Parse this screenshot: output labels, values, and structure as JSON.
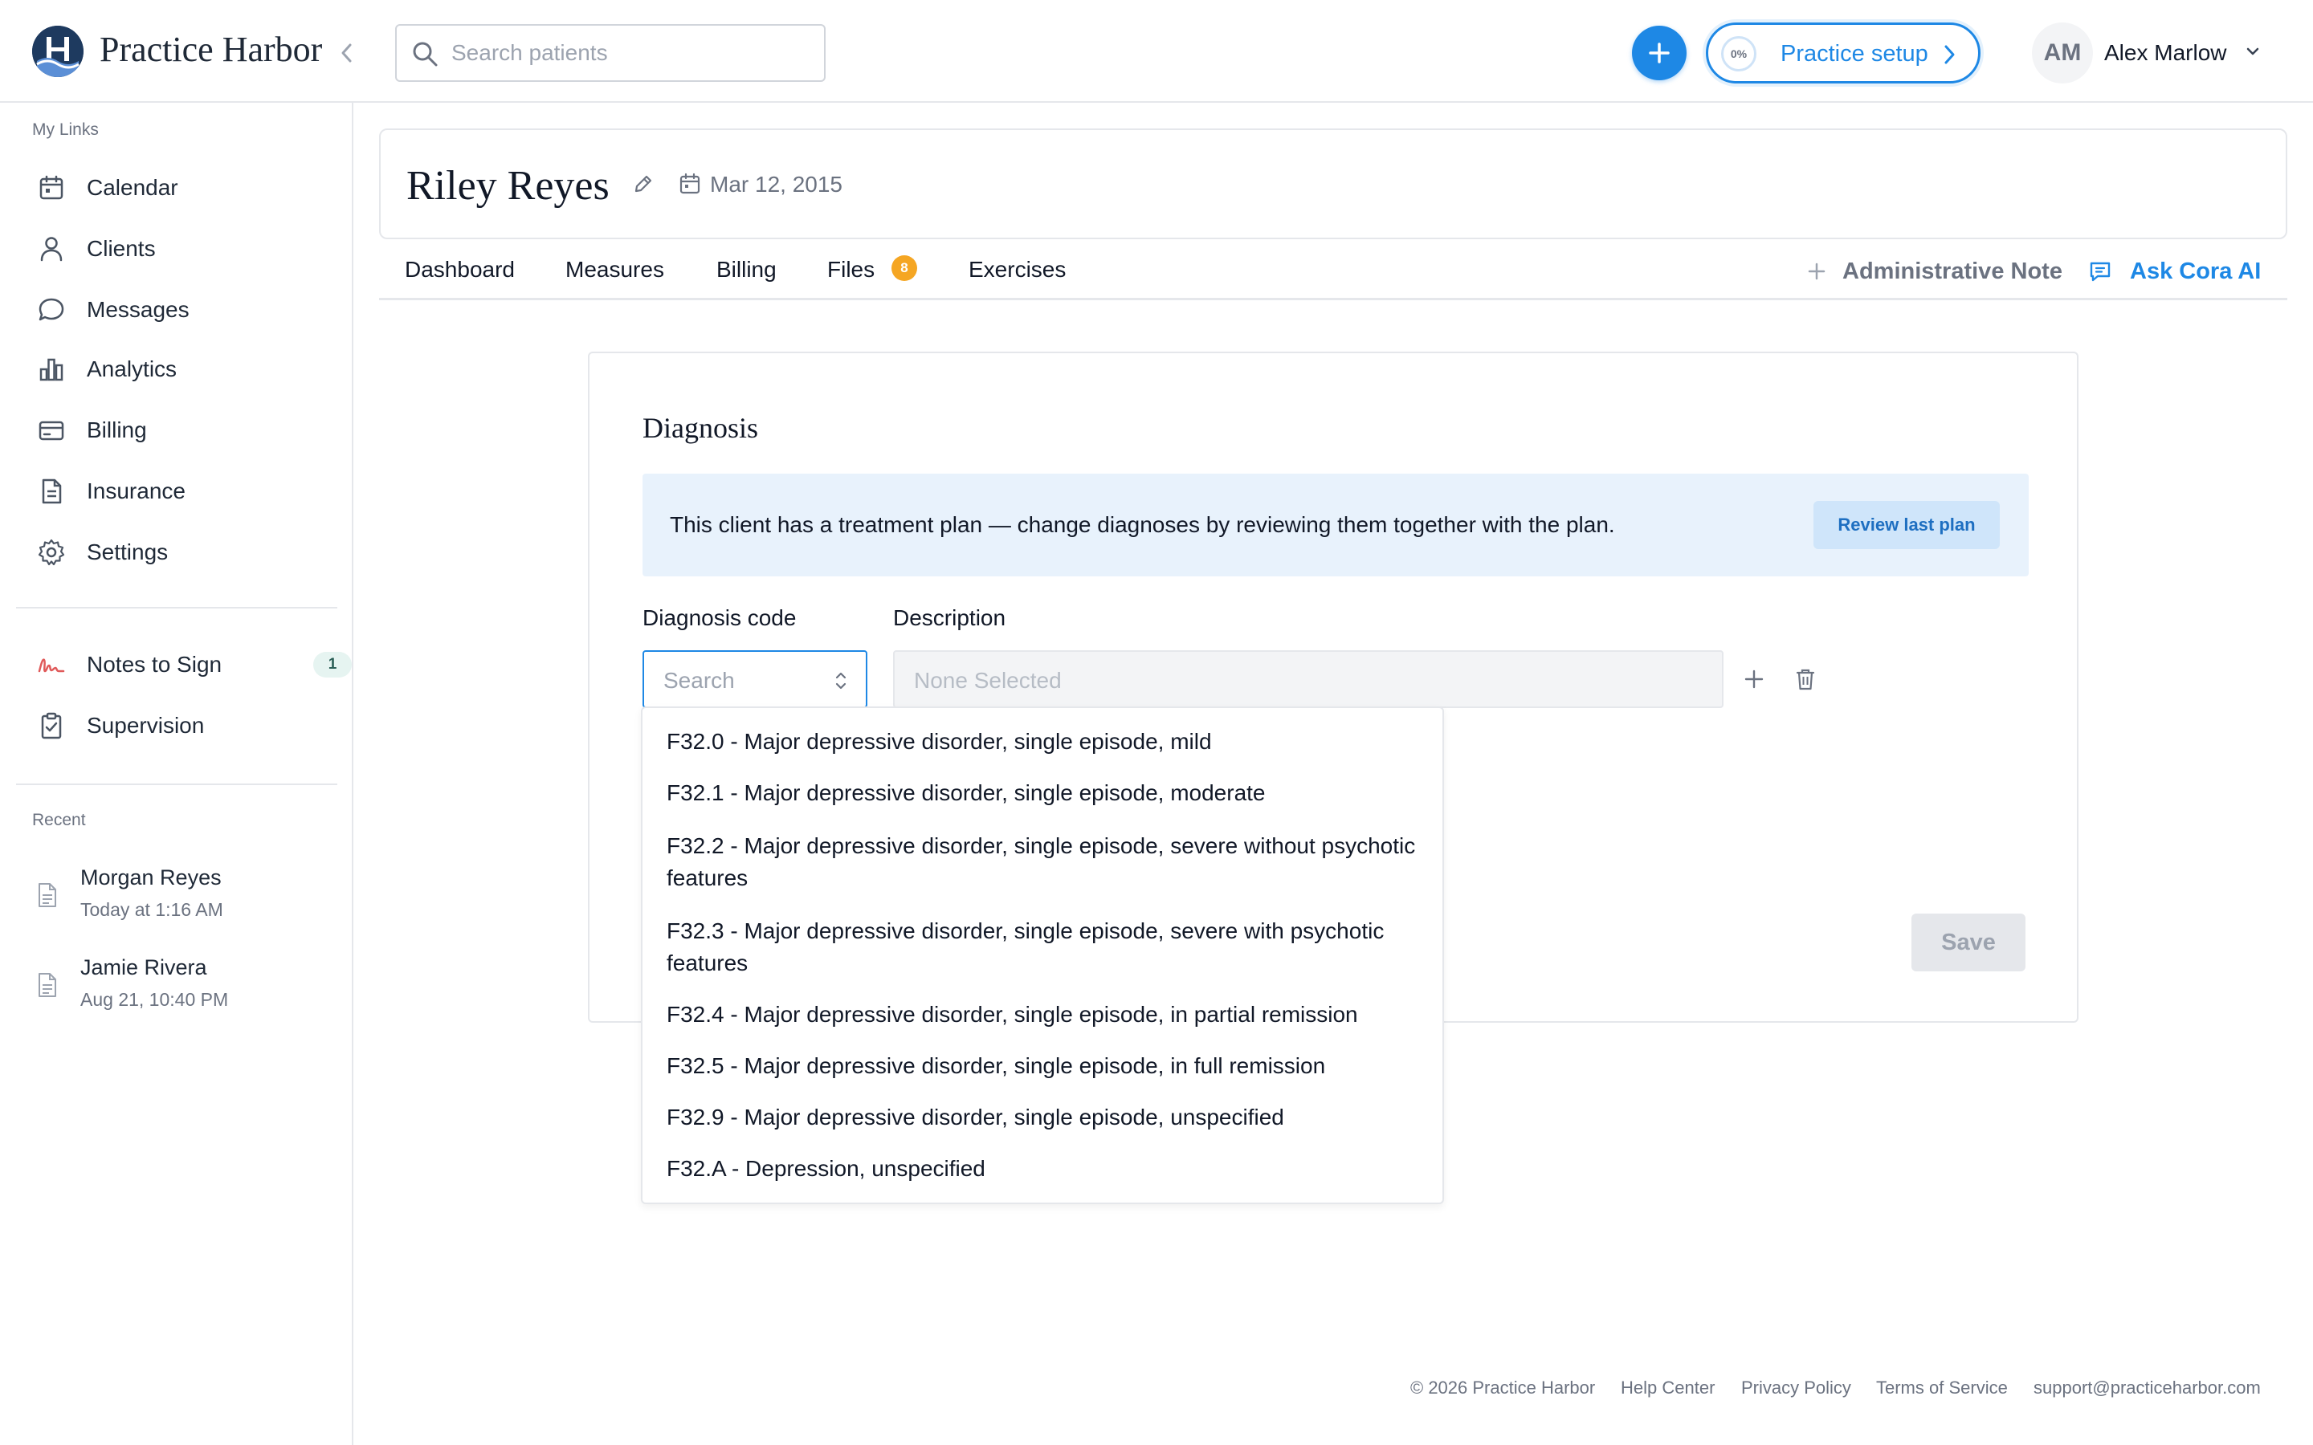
{
  "app": {
    "brand": "Practice Harbor",
    "accent": "#1e88e5",
    "logo_icon": "harbor-logo-icon"
  },
  "header": {
    "search_placeholder": "Search patients",
    "setup_progress": "0%",
    "setup_label": "Practice setup",
    "user_initials": "AM",
    "user_name": "Alex Marlow"
  },
  "sidebar": {
    "my_links_label": "My Links",
    "items": [
      {
        "label": "Calendar",
        "icon": "calendar-icon"
      },
      {
        "label": "Clients",
        "icon": "person-icon"
      },
      {
        "label": "Messages",
        "icon": "chat-bubble-icon"
      },
      {
        "label": "Analytics",
        "icon": "bar-chart-icon"
      },
      {
        "label": "Billing",
        "icon": "credit-card-icon"
      },
      {
        "label": "Insurance",
        "icon": "document-icon"
      },
      {
        "label": "Settings",
        "icon": "gear-icon"
      }
    ],
    "secondary": [
      {
        "label": "Notes to Sign",
        "icon": "signature-icon",
        "count": "1"
      },
      {
        "label": "Supervision",
        "icon": "clipboard-check-icon"
      }
    ],
    "recent_label": "Recent",
    "recent": [
      {
        "name": "Morgan Reyes",
        "time": "Today at 1:16 AM"
      },
      {
        "name": "Jamie Rivera",
        "time": "Aug 21, 10:40 PM"
      }
    ]
  },
  "patient": {
    "name": "Riley Reyes",
    "dob": "Mar 12, 2015"
  },
  "tabs": {
    "items": [
      "Dashboard",
      "Measures",
      "Billing",
      "Files",
      "Exercises"
    ],
    "files_count": "8",
    "admin_note": "Administrative Note",
    "ask_ai": "Ask Cora AI"
  },
  "diagnosis": {
    "title": "Diagnosis",
    "banner_text": "This client has a treatment plan — change diagnoses by reviewing them together with the plan.",
    "review_button": "Review last plan",
    "code_label": "Diagnosis code",
    "description_label": "Description",
    "code_placeholder": "Search",
    "description_placeholder": "None Selected",
    "save_label": "Save",
    "options": [
      "F32.0 - Major depressive disorder, single episode, mild",
      "F32.1 - Major depressive disorder, single episode, moderate",
      "F32.2 - Major depressive disorder, single episode, severe without psychotic features",
      "F32.3 - Major depressive disorder, single episode, severe with psychotic features",
      "F32.4 - Major depressive disorder, single episode, in partial remission",
      "F32.5 - Major depressive disorder, single episode, in full remission",
      "F32.9 - Major depressive disorder, single episode, unspecified",
      "F32.A - Depression, unspecified"
    ]
  },
  "footer": {
    "copyright": "© 2026 Practice Harbor",
    "help": "Help Center",
    "privacy": "Privacy Policy",
    "terms": "Terms of Service",
    "email": "support@practiceharbor.com"
  }
}
